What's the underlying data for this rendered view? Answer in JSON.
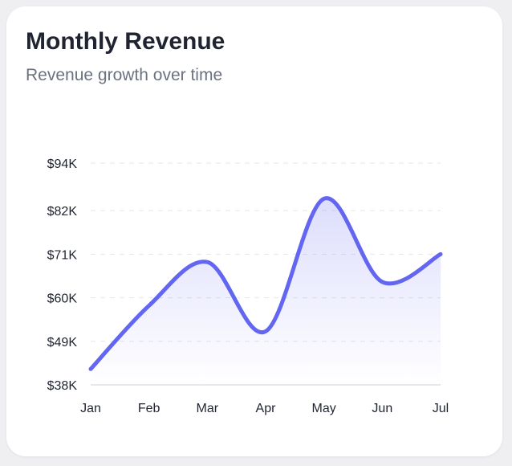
{
  "card": {
    "title": "Monthly Revenue",
    "subtitle": "Revenue growth over time"
  },
  "colors": {
    "line": "#6366f1",
    "fill": "#6366f1",
    "grid": "#e5e7eb",
    "axis": "#e5e7eb",
    "text": "#1f2430",
    "subtext": "#6b7280"
  },
  "chart_data": {
    "type": "area",
    "title": "Monthly Revenue",
    "subtitle": "Revenue growth over time",
    "categories": [
      "Jan",
      "Feb",
      "Mar",
      "Apr",
      "May",
      "Jun",
      "Jul"
    ],
    "series": [
      {
        "values": [
          42000,
          58000,
          69000,
          51500,
          85000,
          64000,
          71000
        ]
      }
    ],
    "ylim": [
      38000,
      94000
    ],
    "yticks": [
      38000,
      49000,
      60000,
      71000,
      82000,
      94000
    ],
    "ytick_labels": [
      "$38K",
      "$49K",
      "$60K",
      "$71K",
      "$82K",
      "$94K"
    ],
    "grid": true,
    "grid_style": "dashed",
    "legend": "none",
    "curve": "smooth"
  }
}
